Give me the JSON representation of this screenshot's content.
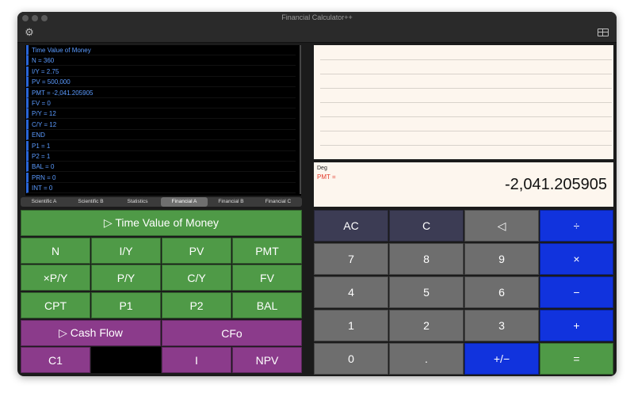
{
  "window": {
    "title": "Financial Calculator++"
  },
  "toolbar": {
    "left_icon": "gear-icon",
    "right_icon": "table-icon"
  },
  "tape": {
    "lines": [
      "Time Value of Money",
      "N = 360",
      "I/Y = 2.75",
      "PV = 500,000",
      "PMT = -2,041.205905",
      "FV = 0",
      "P/Y = 12",
      "C/Y = 12",
      "END",
      "P1 = 1",
      "P2 = 1",
      "BAL = 0",
      "PRN = 0",
      "INT = 0"
    ]
  },
  "tabs": {
    "items": [
      "Scientific A",
      "Scientific B",
      "Statistics",
      "Financial A",
      "Financial B",
      "Financial C"
    ],
    "active": "Financial A"
  },
  "display": {
    "mode": "Deg",
    "label": "PMT =",
    "value": "-2,041.205905"
  },
  "financial_keys": {
    "tvm": "▷ Time Value of Money",
    "row1": [
      "N",
      "I/Y",
      "PV",
      "PMT"
    ],
    "row2": [
      "×P/Y",
      "P/Y",
      "C/Y",
      "FV"
    ],
    "row3": [
      "CPT",
      "P1",
      "P2",
      "BAL"
    ],
    "cashflow": "▷ Cash Flow",
    "cfo": "CFo",
    "row5": [
      "C1",
      "",
      "I",
      "NPV"
    ]
  },
  "keypad": {
    "row1": [
      "AC",
      "C",
      "◁",
      "÷"
    ],
    "row2": [
      "7",
      "8",
      "9",
      "×"
    ],
    "row3": [
      "4",
      "5",
      "6",
      "−"
    ],
    "row4": [
      "1",
      "2",
      "3",
      "+"
    ],
    "row5": [
      "0",
      ".",
      "+/−",
      "="
    ]
  },
  "colors": {
    "green": "#4f9a47",
    "purple": "#8b3b8b",
    "gray": "#6e6e6e",
    "slate": "#3c3c54",
    "blue": "#1133dd",
    "tape_text": "#5b9bff",
    "pmt_label": "#e33a2a"
  }
}
